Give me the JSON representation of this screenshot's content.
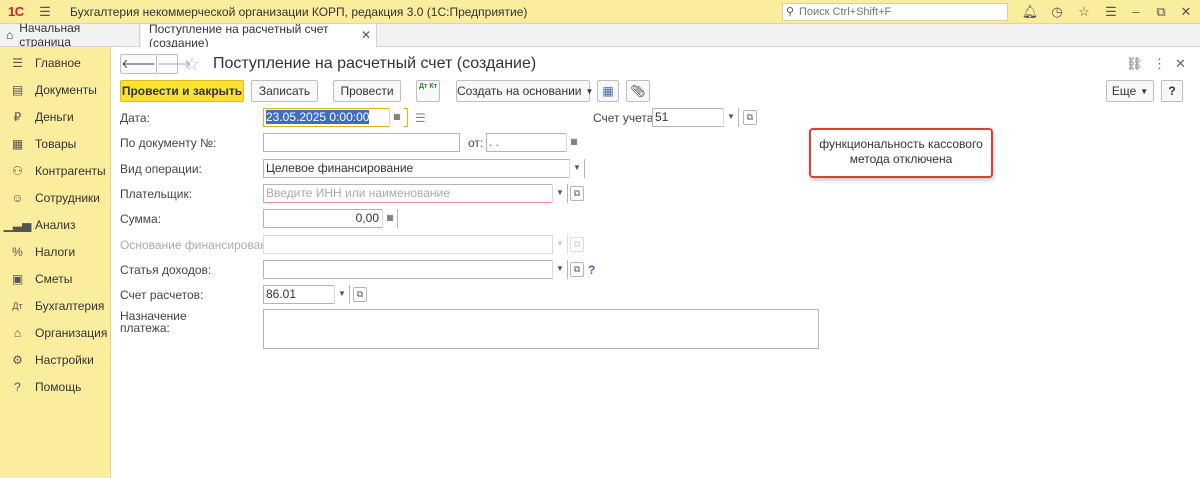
{
  "titlebar": {
    "logo": "1С",
    "title": "Бухгалтерия некоммерческой организации КОРП, редакция 3.0  (1С:Предприятие)",
    "search_placeholder": "Поиск Ctrl+Shift+F"
  },
  "tabs": {
    "home_label": "Начальная страница",
    "active_label": "Поступление на расчетный счет (создание)"
  },
  "sidebar": {
    "items": [
      {
        "label": "Главное",
        "icon": "menu-icon"
      },
      {
        "label": "Документы",
        "icon": "documents-icon"
      },
      {
        "label": "Деньги",
        "icon": "ruble-icon"
      },
      {
        "label": "Товары",
        "icon": "goods-icon"
      },
      {
        "label": "Контрагенты",
        "icon": "contractors-icon"
      },
      {
        "label": "Сотрудники",
        "icon": "employees-icon"
      },
      {
        "label": "Анализ",
        "icon": "analysis-icon"
      },
      {
        "label": "Налоги",
        "icon": "percent-icon"
      },
      {
        "label": "Сметы",
        "icon": "estimates-icon"
      },
      {
        "label": "Бухгалтерия",
        "icon": "accounting-icon"
      },
      {
        "label": "Организация",
        "icon": "organization-icon"
      },
      {
        "label": "Настройки",
        "icon": "settings-icon"
      },
      {
        "label": "Помощь",
        "icon": "help-icon"
      }
    ]
  },
  "form": {
    "title": "Поступление на расчетный счет (создание)",
    "toolbar": {
      "post_close": "Провести и закрыть",
      "save": "Записать",
      "post": "Провести",
      "dtkt": "Дт Кт",
      "create_based": "Создать на основании",
      "more": "Еще",
      "help": "?"
    },
    "fields": {
      "date_label": "Дата:",
      "date_value": "23.05.2025  0:00:00",
      "account_label": "Счет учета:",
      "account_value": "51",
      "docnum_label": "По документу №:",
      "docnum_value": "",
      "from_label": "от:",
      "from_value": " .  .",
      "optype_label": "Вид операции:",
      "optype_value": "Целевое финансирование",
      "payer_label": "Плательщик:",
      "payer_placeholder": "Введите ИНН или наименование",
      "sum_label": "Сумма:",
      "sum_value": "0,00",
      "basis_label": "Основание финансирования:",
      "basis_value": "",
      "income_label": "Статья доходов:",
      "income_value": "",
      "income_help": "?",
      "settle_label": "Счет расчетов:",
      "settle_value": "86.01",
      "purpose_label": "Назначение платежа:",
      "purpose_value": ""
    },
    "callout": "функциональность кассового метода отключена"
  }
}
